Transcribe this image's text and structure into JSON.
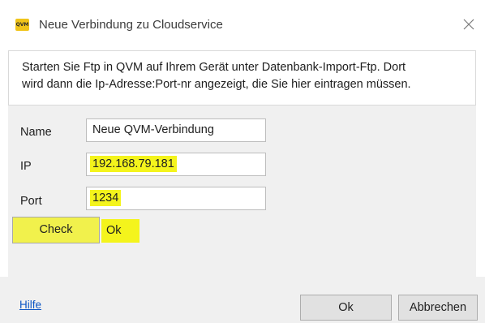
{
  "window": {
    "title": "Neue Verbindung zu Cloudservice",
    "app_icon_label": "QVM",
    "close_glyph": "✕"
  },
  "info": {
    "text": "Starten Sie Ftp in QVM auf Ihrem Gerät unter Datenbank-Import-Ftp. Dort\nwird dann die Ip-Adresse:Port-nr angezeigt, die Sie hier eintragen müssen."
  },
  "form": {
    "name": {
      "label": "Name",
      "value": "Neue QVM-Verbindung"
    },
    "ip": {
      "label": "IP",
      "value": "192.168.79.181"
    },
    "port": {
      "label": "Port",
      "value": "1234"
    },
    "check_button": "Check",
    "check_result": "Ok",
    "highlight_color": "#f4f41c"
  },
  "footer": {
    "help_link": "Hilfe",
    "ok_button": "Ok",
    "cancel_button": "Abbrechen"
  }
}
